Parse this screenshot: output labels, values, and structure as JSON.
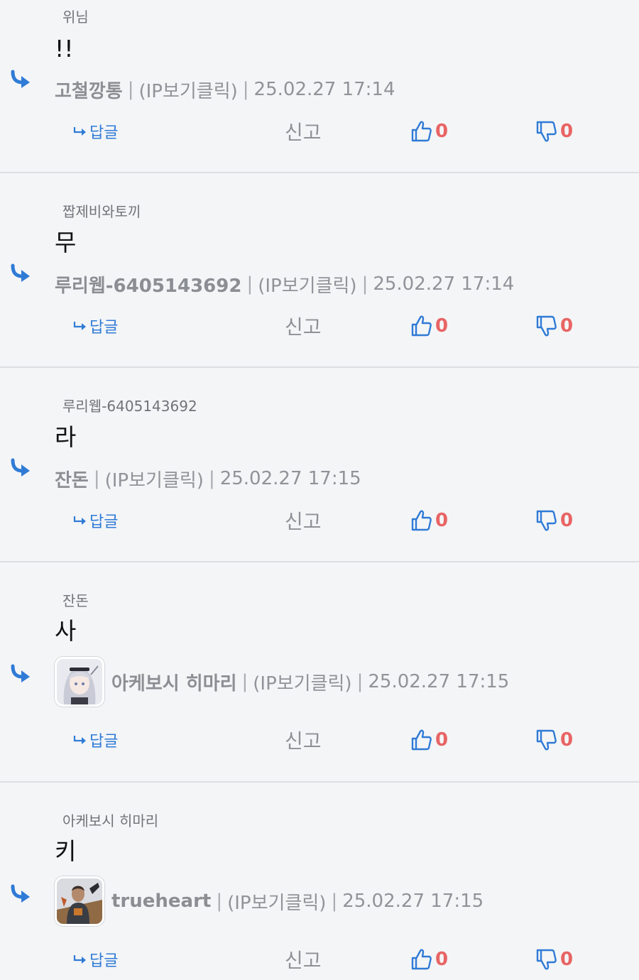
{
  "colors": {
    "background": "#f4f5f7",
    "divider": "#dcdee2",
    "accent_blue": "#2f7bd6",
    "vote_count_red": "#e86464"
  },
  "labels": {
    "reply": "답글",
    "report": "신고",
    "separator": "|"
  },
  "icons": {
    "reply_arrow": "reply-arrow-icon",
    "thumbs_up": "thumbs-up-icon",
    "thumbs_down": "thumbs-down-icon"
  },
  "comments": [
    {
      "reply_to": "위님",
      "text": "!!",
      "author": "고철깡통",
      "ip_label": "(IP보기클릭)",
      "date": "25.02.27 17:14",
      "likes": "0",
      "dislikes": "0"
    },
    {
      "reply_to": "짭제비와토끼",
      "text": "무",
      "author": "루리웹-6405143692",
      "ip_label": "(IP보기클릭)",
      "date": "25.02.27 17:14",
      "likes": "0",
      "dislikes": "0"
    },
    {
      "reply_to": "루리웹-6405143692",
      "text": "라",
      "author": "잔돈",
      "ip_label": "(IP보기클릭)",
      "date": "25.02.27 17:15",
      "likes": "0",
      "dislikes": "0"
    },
    {
      "reply_to": "잔돈",
      "text": "사",
      "author": "아케보시 히마리",
      "ip_label": "(IP보기클릭)",
      "date": "25.02.27 17:15",
      "likes": "0",
      "dislikes": "0"
    },
    {
      "reply_to": "아케보시 히마리",
      "text": "키",
      "author": "trueheart",
      "ip_label": "(IP보기클릭)",
      "date": "25.02.27 17:15",
      "likes": "0",
      "dislikes": "0"
    }
  ]
}
